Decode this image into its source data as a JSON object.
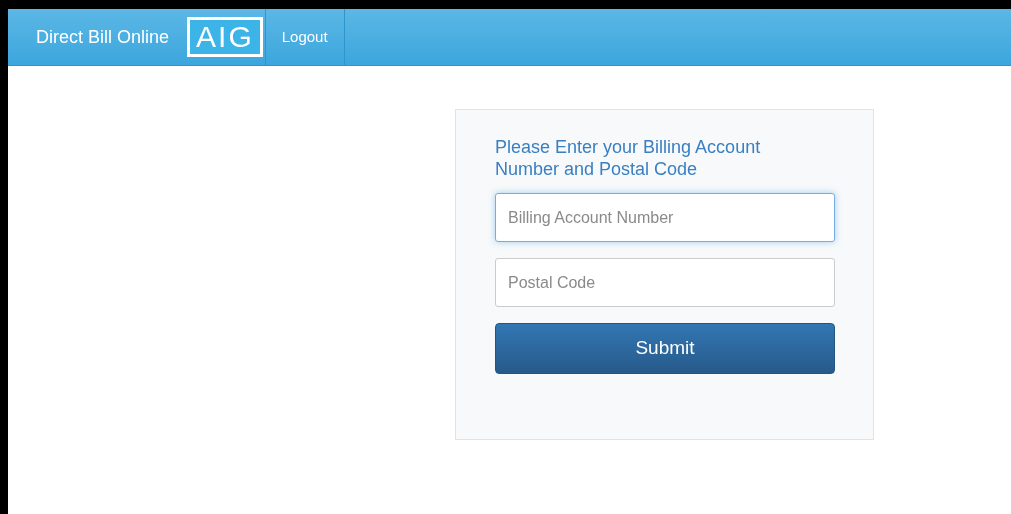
{
  "navbar": {
    "brand": "Direct Bill Online",
    "logo": "AIG",
    "links": [
      {
        "label": "Logout"
      }
    ]
  },
  "form": {
    "heading": "Please Enter your Billing Account Number and Postal Code",
    "fields": [
      {
        "placeholder": "Billing Account Number",
        "focused": true
      },
      {
        "placeholder": "Postal Code",
        "focused": false
      }
    ],
    "submit": "Submit"
  }
}
